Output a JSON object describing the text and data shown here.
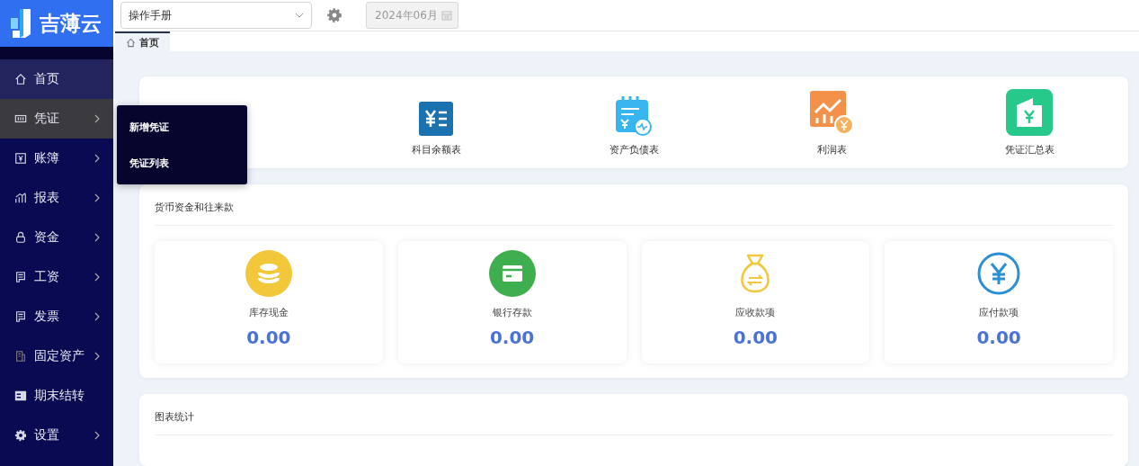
{
  "logo": {
    "text": "吉薄云"
  },
  "toolbar": {
    "manual_select": {
      "value": "操作手册"
    },
    "period": {
      "value": "2024年06月",
      "disabled": true
    }
  },
  "sidebar": {
    "items": [
      {
        "label": "首页",
        "kind": "link",
        "selected": true,
        "hovered": false
      },
      {
        "label": "凭证",
        "kind": "group",
        "selected": false,
        "hovered": true
      },
      {
        "label": "账簿",
        "kind": "group",
        "selected": false,
        "hovered": false
      },
      {
        "label": "报表",
        "kind": "group",
        "selected": false,
        "hovered": false
      },
      {
        "label": "资金",
        "kind": "group",
        "selected": false,
        "hovered": false
      },
      {
        "label": "工资",
        "kind": "group",
        "selected": false,
        "hovered": false
      },
      {
        "label": "发票",
        "kind": "group",
        "selected": false,
        "hovered": false
      },
      {
        "label": "固定资产",
        "kind": "group",
        "selected": false,
        "hovered": false
      },
      {
        "label": "期末结转",
        "kind": "link",
        "selected": false,
        "hovered": false
      },
      {
        "label": "设置",
        "kind": "group",
        "selected": false,
        "hovered": false
      }
    ]
  },
  "submenu": {
    "items": [
      {
        "label": "新增凭证"
      },
      {
        "label": "凭证列表"
      }
    ]
  },
  "tabs": [
    {
      "label": "首页",
      "selected": true
    }
  ],
  "quick_links": [
    {
      "label": "科目余额表"
    },
    {
      "label": "资产负债表"
    },
    {
      "label": "利润表"
    },
    {
      "label": "凭证汇总表"
    }
  ],
  "funds": {
    "title": "货币资金和往来款",
    "items": [
      {
        "label": "库存现金",
        "value": "0.00",
        "color": "#f3c73a"
      },
      {
        "label": "银行存款",
        "value": "0.00",
        "color": "#3fae4f"
      },
      {
        "label": "应收款项",
        "value": "0.00",
        "color": "#f3c73a"
      },
      {
        "label": "应付款项",
        "value": "0.00",
        "color": "#2a8fd4"
      }
    ]
  },
  "charts": {
    "title": "图表统计"
  }
}
